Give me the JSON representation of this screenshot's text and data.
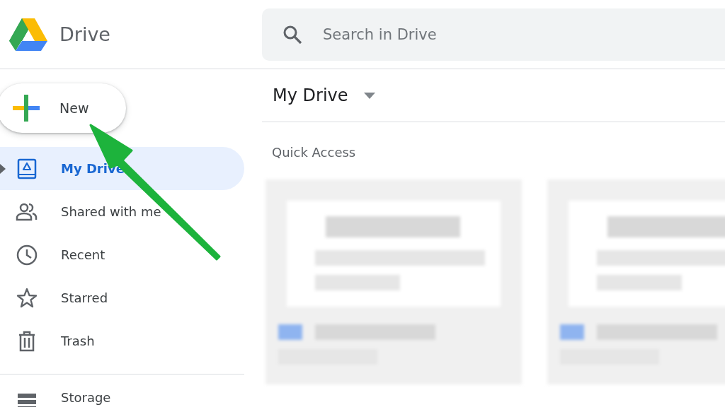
{
  "app": {
    "name": "Drive"
  },
  "search": {
    "placeholder": "Search in Drive"
  },
  "new_button": {
    "label": "New"
  },
  "sidebar": {
    "items": [
      {
        "kind": "drive",
        "label": "My Drive",
        "selected": true,
        "expanded": false
      },
      {
        "kind": "people",
        "label": "Shared with me",
        "selected": false
      },
      {
        "kind": "clock",
        "label": "Recent",
        "selected": false
      },
      {
        "kind": "star",
        "label": "Starred",
        "selected": false
      },
      {
        "kind": "trash",
        "label": "Trash",
        "selected": false
      }
    ],
    "footer_items": [
      {
        "kind": "storage",
        "label": "Storage",
        "selected": false
      }
    ]
  },
  "main": {
    "title": "My Drive",
    "section": "Quick Access",
    "cards": [
      {
        "kind": "document"
      },
      {
        "kind": "document"
      }
    ]
  }
}
